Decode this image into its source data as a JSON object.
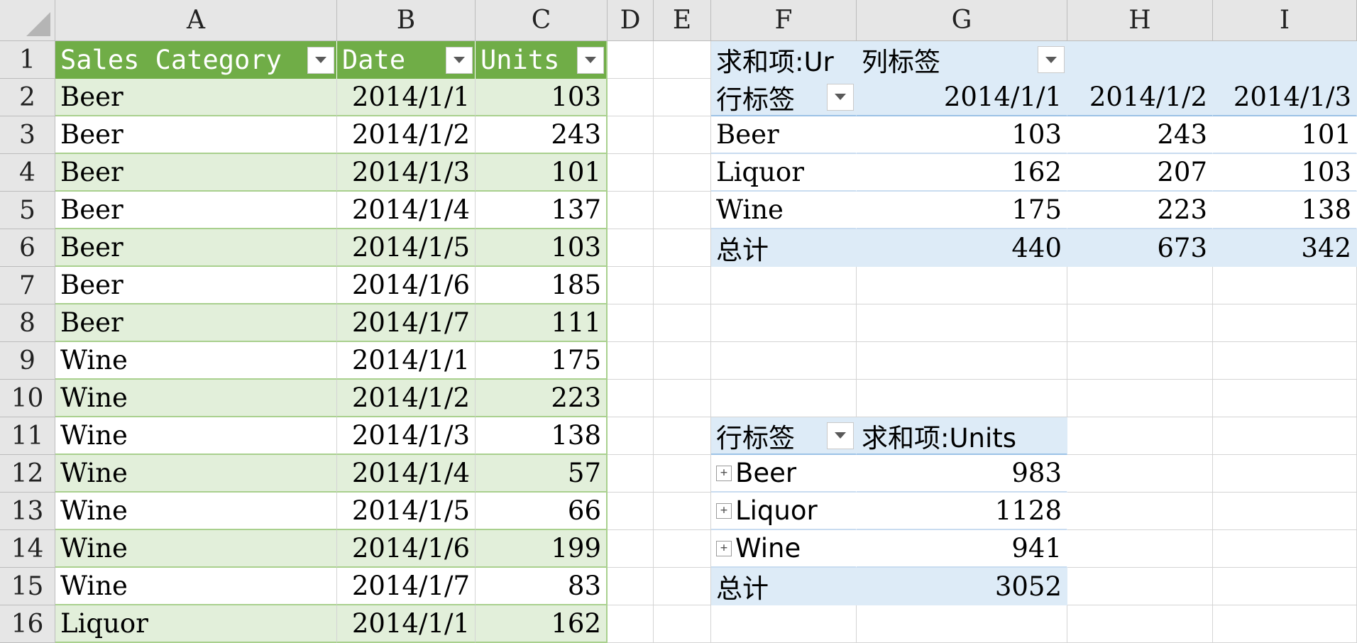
{
  "columns": [
    "A",
    "B",
    "C",
    "D",
    "E",
    "F",
    "G",
    "H",
    "I"
  ],
  "rows": [
    "1",
    "2",
    "3",
    "4",
    "5",
    "6",
    "7",
    "8",
    "9",
    "10",
    "11",
    "12",
    "13",
    "14",
    "15",
    "16"
  ],
  "table": {
    "headers": [
      "Sales Category",
      "Date",
      "Units"
    ],
    "rows": [
      [
        "Beer",
        "2014/1/1",
        "103"
      ],
      [
        "Beer",
        "2014/1/2",
        "243"
      ],
      [
        "Beer",
        "2014/1/3",
        "101"
      ],
      [
        "Beer",
        "2014/1/4",
        "137"
      ],
      [
        "Beer",
        "2014/1/5",
        "103"
      ],
      [
        "Beer",
        "2014/1/6",
        "185"
      ],
      [
        "Beer",
        "2014/1/7",
        "111"
      ],
      [
        "Wine",
        "2014/1/1",
        "175"
      ],
      [
        "Wine",
        "2014/1/2",
        "223"
      ],
      [
        "Wine",
        "2014/1/3",
        "138"
      ],
      [
        "Wine",
        "2014/1/4",
        "57"
      ],
      [
        "Wine",
        "2014/1/5",
        "66"
      ],
      [
        "Wine",
        "2014/1/6",
        "199"
      ],
      [
        "Wine",
        "2014/1/7",
        "83"
      ],
      [
        "Liquor",
        "2014/1/1",
        "162"
      ]
    ]
  },
  "pivot1": {
    "value_label": "求和项:Ur",
    "col_label": "列标签",
    "row_label": "行标签",
    "col_headers": [
      "2014/1/1",
      "2014/1/2",
      "2014/1/3"
    ],
    "rows": [
      {
        "label": "Beer",
        "values": [
          "103",
          "243",
          "101"
        ]
      },
      {
        "label": "Liquor",
        "values": [
          "162",
          "207",
          "103"
        ]
      },
      {
        "label": "Wine",
        "values": [
          "175",
          "223",
          "138"
        ]
      }
    ],
    "total_label": "总计",
    "totals": [
      "440",
      "673",
      "342"
    ]
  },
  "pivot2": {
    "row_label": "行标签",
    "value_label": "求和项:Units",
    "rows": [
      {
        "label": "Beer",
        "value": "983"
      },
      {
        "label": "Liquor",
        "value": "1128"
      },
      {
        "label": "Wine",
        "value": "941"
      }
    ],
    "total_label": "总计",
    "total": "3052"
  },
  "icons": {
    "filter": "dropdown-arrow-icon",
    "expand": "expand-plus-icon"
  },
  "colors": {
    "table_header": "#70ad47",
    "table_band": "#e2efda",
    "pivot_band": "#ddebf7",
    "header_bg": "#e6e6e6"
  }
}
